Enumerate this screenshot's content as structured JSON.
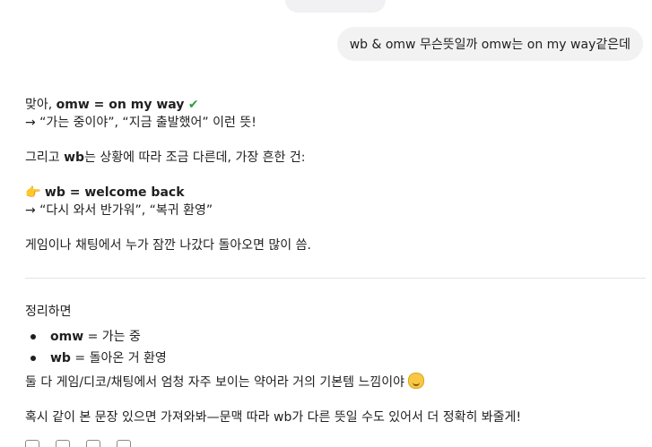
{
  "user_message": "wb & omw 무슨뜻일까 omw는 on my way같은데",
  "answer": {
    "p1_prefix": "맞아, ",
    "p1_bold": "omw = on my way",
    "p1_check": "✔",
    "p1_line2": "→ “가는 중이야”, “지금 출발했어” 이런 뜻!",
    "p2_prefix": "그리고 ",
    "p2_bold": "wb",
    "p2_rest": "는 상황에 따라 조금 다른데, 가장 흔한 건:",
    "p3_emoji": "👉",
    "p3_bold": "wb = welcome back",
    "p3_line2": "→ “다시 와서 반가워”, “복귀 환영”",
    "p4": "게임이나 채팅에서 누가 잠깐 나갔다 돌아오면 많이 씀.",
    "summary_title": "정리하면",
    "summary_items": [
      {
        "term": "omw",
        "desc": " = 가는 중"
      },
      {
        "term": "wb",
        "desc": " = 돌아온 거 환영"
      }
    ],
    "p5": "둘 다 게임/디코/채팅에서 엄청 자주 보이는 약어라 거의 기본템 느낌이야",
    "p6": "혹시 같이 본 문장 있으면 가져와봐—문맥 따라 wb가 다른 뜻일 수도 있어서 더 정확히 봐줄게!"
  }
}
